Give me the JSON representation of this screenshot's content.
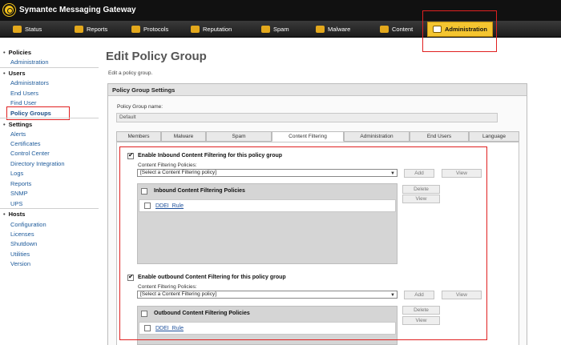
{
  "app": {
    "title": "Symantec Messaging Gateway"
  },
  "nav": {
    "items": [
      {
        "label": "Status",
        "icon": "status-icon"
      },
      {
        "label": "Reports",
        "icon": "reports-icon"
      },
      {
        "label": "Protocols",
        "icon": "protocols-icon"
      },
      {
        "label": "Reputation",
        "icon": "reputation-icon"
      },
      {
        "label": "Spam",
        "icon": "spam-icon"
      },
      {
        "label": "Malware",
        "icon": "malware-icon"
      },
      {
        "label": "Content",
        "icon": "content-icon"
      },
      {
        "label": "Administration",
        "icon": "administration-icon"
      }
    ],
    "active": "Administration"
  },
  "sidebar": {
    "policies": {
      "heading": "Policies",
      "items": [
        "Administration"
      ]
    },
    "users": {
      "heading": "Users",
      "items": [
        "Administrators",
        "End Users",
        "Find User",
        "Policy Groups"
      ]
    },
    "settings": {
      "heading": "Settings",
      "items": [
        "Alerts",
        "Certificates",
        "Control Center",
        "Directory Integration",
        "Logs",
        "Reports",
        "SNMP",
        "UPS"
      ]
    },
    "hosts": {
      "heading": "Hosts",
      "items": [
        "Configuration",
        "Licenses",
        "Shutdown",
        "Utilities",
        "Version"
      ]
    },
    "selected": "Policy Groups"
  },
  "main": {
    "title": "Edit Policy Group",
    "subtitle": "Edit a policy group.",
    "panel_title": "Policy Group Settings",
    "group_name_label": "Policy Group name:",
    "group_name_value": "Default",
    "tabs": [
      "Members",
      "Malware",
      "Spam",
      "Content Filtering",
      "Administration",
      "End Users",
      "Language"
    ],
    "active_tab": "Content Filtering"
  },
  "inbound": {
    "checkbox_label": "Enable Inbound Content Filtering for this policy group",
    "checked": true,
    "policies_label": "Content Filtering Policies:",
    "select_value": "[Select a Content Filtering policy]",
    "add": "Add",
    "view": "View",
    "table_header": "Inbound Content Filtering Policies",
    "delete": "Delete",
    "view2": "View",
    "rows": [
      "DDEI_Rule"
    ]
  },
  "outbound": {
    "checkbox_label": "Enable outbound Content Filtering for this policy group",
    "checked": true,
    "policies_label": "Content Filtering Policies:",
    "select_value": "[Select a Content Filtering policy]",
    "add": "Add",
    "view": "View",
    "table_header": "Outbound Content Filtering Policies",
    "delete": "Delete",
    "view2": "View",
    "rows": [
      "DDEI_Rule"
    ]
  },
  "colors": {
    "accent": "#f4c530",
    "annotation": "#e02020",
    "link": "#1d5a9a"
  }
}
